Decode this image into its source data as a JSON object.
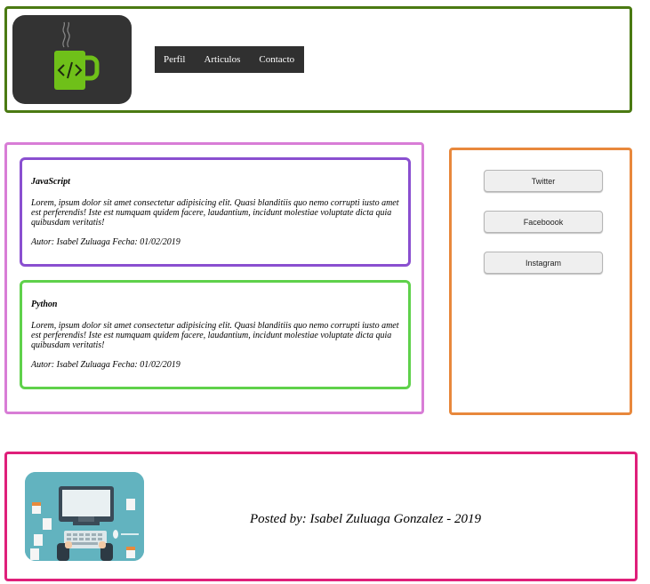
{
  "header": {
    "nav": [
      "Perfil",
      "Articulos",
      "Contacto"
    ]
  },
  "articles": [
    {
      "title": "JavaScript",
      "body": "Lorem, ipsum dolor sit amet consectetur adipisicing elit. Quasi blanditiis quo nemo corrupti iusto amet est perferendis! Iste est numquam quidem facere, laudantium, incidunt molestiae voluptate dicta quia quibusdam veritatis!",
      "meta": "Autor: Isabel Zuluaga Fecha: 01/02/2019"
    },
    {
      "title": "Python",
      "body": "Lorem, ipsum dolor sit amet consectetur adipisicing elit. Quasi blanditiis quo nemo corrupti iusto amet est perferendis! Iste est numquam quidem facere, laudantium, incidunt molestiae voluptate dicta quia quibusdam veritatis!",
      "meta": "Autor: Isabel Zuluaga Fecha: 01/02/2019"
    }
  ],
  "social": {
    "twitter": "Twitter",
    "facebook": "Faceboook",
    "instagram": "Instagram"
  },
  "footer": {
    "text": "Posted by: Isabel Zuluaga Gonzalez - 2019"
  },
  "colors": {
    "header_border": "#4a7a12",
    "main_border": "#d87dd6",
    "article_js_border": "#8a4fd0",
    "article_py_border": "#5fd14b",
    "aside_border": "#e8883c",
    "footer_border": "#df1f7a",
    "logo_mug": "#6fc019"
  },
  "icons": {
    "logo": "code-mug-icon",
    "footer_image": "developer-desk-illustration"
  }
}
